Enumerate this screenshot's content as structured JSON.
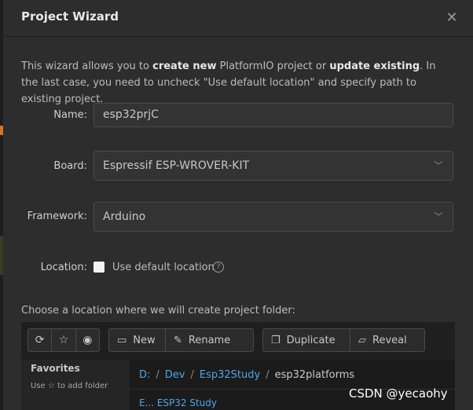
{
  "dialog": {
    "title": "Project Wizard",
    "close_glyph": "✕"
  },
  "intro": {
    "part1": "This wizard allows you to ",
    "bold1": "create new",
    "part2": " PlatformIO project or ",
    "bold2": "update existing",
    "part3": ". In the last case, you need to uncheck \"Use default location\" and specify path to existing project."
  },
  "form": {
    "name_label": "Name:",
    "name_value": "esp32prjC",
    "board_label": "Board:",
    "board_value": "Espressif ESP-WROVER-KIT",
    "framework_label": "Framework:",
    "framework_value": "Arduino",
    "location_label": "Location:",
    "use_default_label": "Use default location",
    "use_default_checked": false,
    "help_glyph": "?"
  },
  "chooser": {
    "label": "Choose a location where we will create project folder:",
    "toolbar": {
      "refresh_icon": "⟳",
      "star_icon": "☆",
      "eye_icon": "◉",
      "new_label": "New",
      "rename_label": "Rename",
      "duplicate_label": "Duplicate",
      "reveal_label": "Reveal"
    },
    "favorites": {
      "title": "Favorites",
      "hint": "Use ☆ to add folder"
    },
    "breadcrumb": [
      {
        "label": "D:",
        "link": true
      },
      {
        "label": "Dev",
        "link": true
      },
      {
        "label": "Esp32Study",
        "link": true
      },
      {
        "label": "esp32platforms",
        "link": false
      }
    ],
    "list_stub": "E... ESP32 Study"
  },
  "watermark": "CSDN @yecaohy",
  "colors": {
    "background": "#2d2d2d",
    "link": "#4ea6e8",
    "accent_orange": "#d0742a"
  }
}
